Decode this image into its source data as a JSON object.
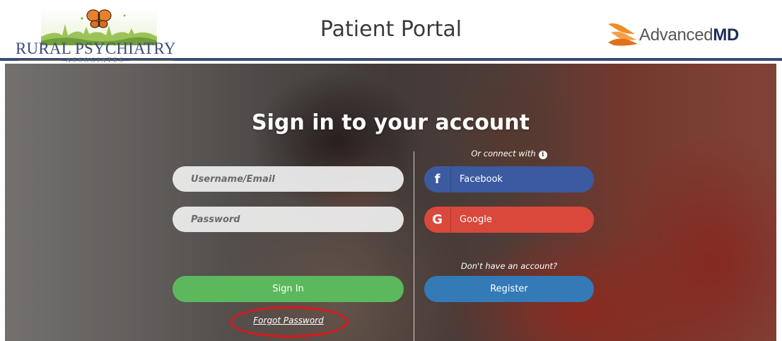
{
  "header": {
    "practice_logo": {
      "name": "RURAL PSYCHIATRY",
      "subtitle": "ASSOCIATES"
    },
    "title": "Patient Portal",
    "vendor_logo": {
      "prefix": "Advanced",
      "suffix": "MD",
      "colors": {
        "orange": "#f28c28",
        "navy": "#1f2e5a"
      }
    },
    "rule_color": "#3b4a78"
  },
  "signin": {
    "heading": "Sign in to your account",
    "username_placeholder": "Username/Email",
    "password_placeholder": "Password",
    "signin_label": "Sign In",
    "forgot_label": "Forgot Password"
  },
  "social": {
    "caption": "Or connect with",
    "facebook": {
      "icon": "f",
      "label": "Facebook",
      "color": "#3b5aa0"
    },
    "google": {
      "icon": "G",
      "label": "Google",
      "color": "#d9483b"
    }
  },
  "register": {
    "caption": "Don't have an account?",
    "label": "Register"
  },
  "colors": {
    "signin_green": "#5cb85c",
    "register_blue": "#337ab7",
    "annotation_red": "#e3141b"
  }
}
